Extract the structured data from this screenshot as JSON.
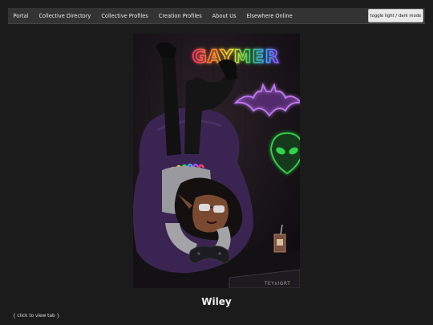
{
  "nav": {
    "items": [
      {
        "label": "Portal"
      },
      {
        "label": "Collective Directory"
      },
      {
        "label": "Collective Profiles"
      },
      {
        "label": "Creation Profiles"
      },
      {
        "label": "About Us"
      },
      {
        "label": "Elsewhere Online"
      }
    ],
    "toggle_label": "toggle light / dark mode"
  },
  "artwork": {
    "sign_text": "GAYMER",
    "signature": "TEYxIGRT"
  },
  "profile": {
    "name": "Wiley",
    "tab_link": "{ click to view tab }"
  },
  "colors": {
    "page_background": "#1b1b1b",
    "navbar_background": "#333333",
    "bat_neon": "#c078f0",
    "alien_neon": "#32d24a"
  }
}
